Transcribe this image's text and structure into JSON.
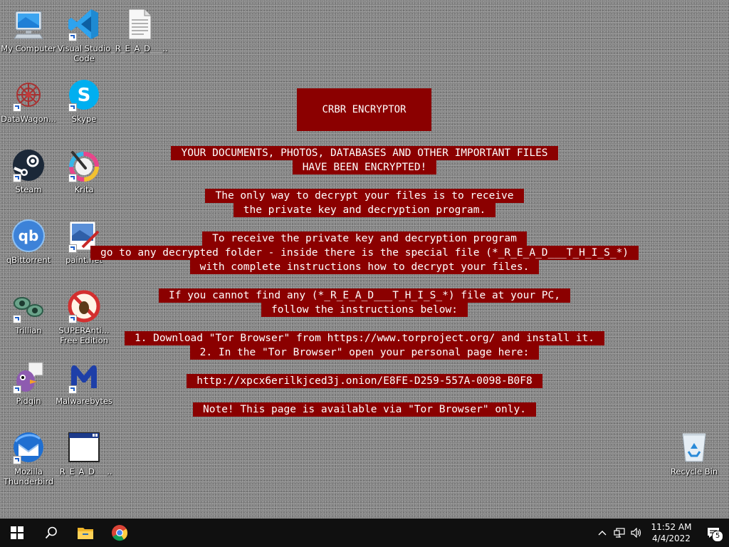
{
  "desktop": {
    "icons": [
      {
        "label": "My Computer"
      },
      {
        "label": "Visual Studio Code"
      },
      {
        "label": "_R_E_A_D___..."
      },
      {
        "label": "DataWagon..."
      },
      {
        "label": "Skype"
      },
      {
        "label": "Steam"
      },
      {
        "label": "Krita"
      },
      {
        "label": "qBittorrent"
      },
      {
        "label": "paint.net"
      },
      {
        "label": "Trillian"
      },
      {
        "label": "SUPERAnti... Free Edition"
      },
      {
        "label": "Pidgin"
      },
      {
        "label": "Malwarebytes"
      },
      {
        "label": "Mozilla Thunderbird"
      },
      {
        "label": "_R_E_A_D___..."
      },
      {
        "label": "Recycle Bin"
      }
    ]
  },
  "note": {
    "title": "CRBR ENCRYPTOR",
    "lines": [
      "YOUR DOCUMENTS, PHOTOS, DATABASES AND OTHER IMPORTANT FILES",
      "HAVE BEEN ENCRYPTED!",
      "The only way to decrypt your files is to receive",
      "the private key and decryption program.",
      "To receive the private key and decryption program",
      "go to any decrypted folder - inside there is the special file (*_R_E_A_D___T_H_I_S_*)",
      "with complete instructions how to decrypt your files.",
      "If you cannot find any (*_R_E_A_D___T_H_I_S_*) file at your PC,",
      "follow the instructions below:",
      "1. Download \"Tor Browser\" from https://www.torproject.org/ and install it.",
      "2. In the \"Tor Browser\" open your personal page here:",
      "http://xpcx6erilkjced3j.onion/E8FE-D259-557A-0098-B0F8",
      "Note! This page is available via \"Tor Browser\" only."
    ]
  },
  "taskbar": {
    "clock_time": "11:52 AM",
    "clock_date": "4/4/2022",
    "notification_count": "5"
  },
  "colors": {
    "note_background": "#8b0000",
    "taskbar": "#101010"
  }
}
